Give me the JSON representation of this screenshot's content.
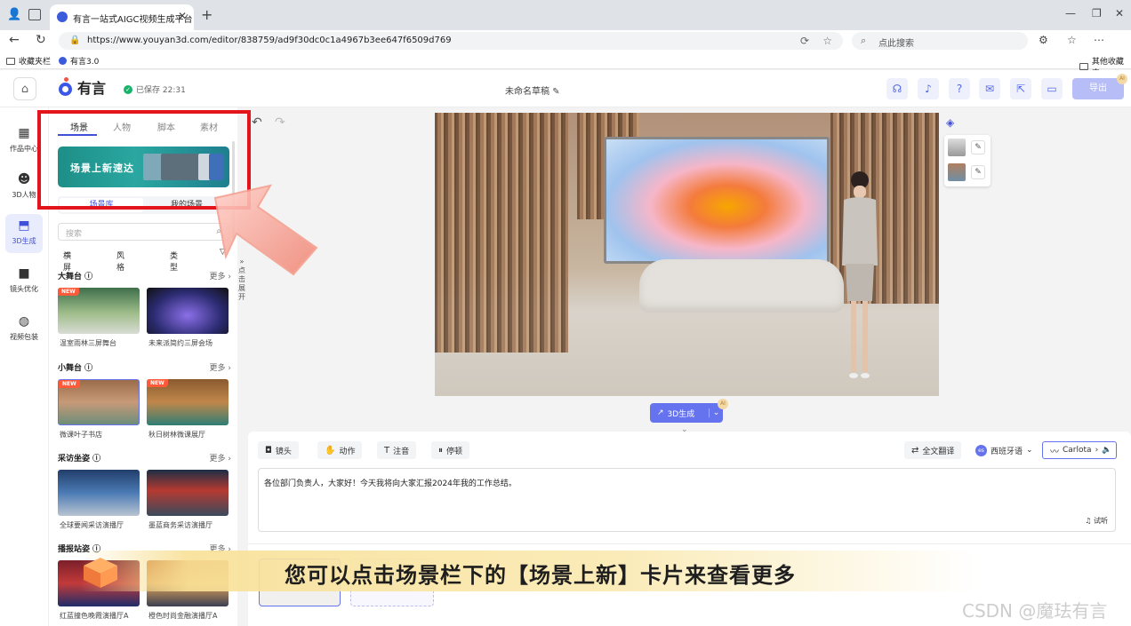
{
  "browser": {
    "tab_title": "有言一站式AIGC视频生成平台",
    "url": "https://www.youyan3d.com/editor/838759/ad9f30dc0c1a4967b3ee647f6509d769",
    "search_placeholder": "点此搜索",
    "bookmarks": {
      "favorites": "收藏夹栏",
      "youyan": "有言3.0",
      "others": "其他收藏夹"
    }
  },
  "header": {
    "logo": "有言",
    "saved": "已保存 22:31",
    "draft_title": "未命名草稿",
    "export": "导出",
    "ai_badge": "AI"
  },
  "rail": [
    {
      "label": "作品中心",
      "icon": "grid-icon"
    },
    {
      "label": "3D人物",
      "icon": "person-icon"
    },
    {
      "label": "3D生成",
      "icon": "chart-icon"
    },
    {
      "label": "镜头优化",
      "icon": "camera-icon"
    },
    {
      "label": "视频包装",
      "icon": "palette-icon"
    }
  ],
  "panel": {
    "tabs": [
      "场景",
      "人物",
      "脚本",
      "素材"
    ],
    "banner": "场景上新速达",
    "subtabs": [
      "场景库",
      "我的场景"
    ],
    "search_placeholder": "搜索",
    "filters": [
      "横屏",
      "风格",
      "类型"
    ],
    "more": "更多",
    "sections": [
      {
        "name": "大舞台",
        "items": [
          "温室雨林三屏舞台",
          "未来派简约三屏会场"
        ]
      },
      {
        "name": "小舞台",
        "items": [
          "微课叶子书店",
          "秋日树林微课展厅"
        ]
      },
      {
        "name": "采访坐姿",
        "items": [
          "全球要闻采访演播厅",
          "墨蓝商务采访演播厅"
        ]
      },
      {
        "name": "播报站姿",
        "items": [
          "红蓝撞色晚霞演播厅A",
          "橙色时尚金融演播厅A"
        ]
      }
    ],
    "expand_text": "点击展开"
  },
  "editor": {
    "gen3d": "3D生成",
    "tools": [
      "镜头",
      "动作",
      "注音",
      "停顿"
    ],
    "translate": "全文翻译",
    "language": "西班牙语",
    "language_badge": "es",
    "voice": "Carlota",
    "script_text": "各位部门负责人，大家好！今天我将向大家汇报2024年我的工作总结。",
    "try_listen": "试听"
  },
  "overlay": {
    "subtitle": "您可以点击场景栏下的【场景上新】卡片来查看更多",
    "watermark": "CSDN @魔珐有言"
  },
  "colors": {
    "accent": "#4150d8",
    "highlight": "#e3141b"
  }
}
